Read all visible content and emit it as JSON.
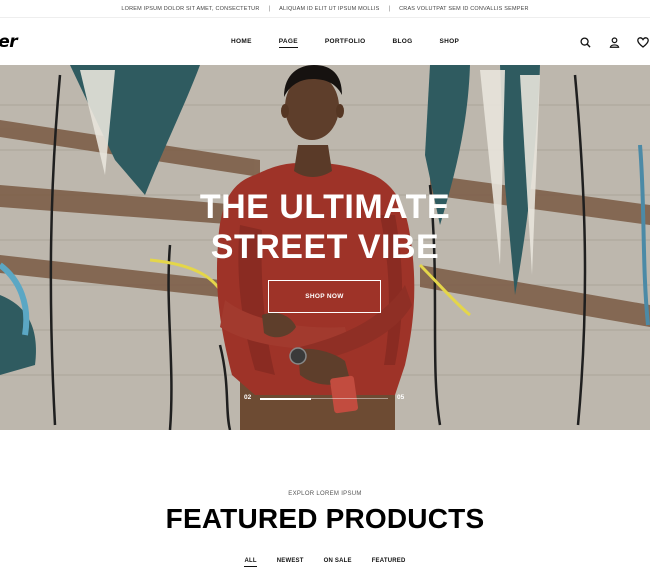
{
  "topbar": {
    "messages": [
      "LOREM IPSUM DOLOR SIT AMET, CONSECTETUR",
      "ALIQUAM ID ELIT UT IPSUM MOLLIS",
      "CRAS VOLUTPAT SEM ID CONVALLIS SEMPER"
    ],
    "separator": "|"
  },
  "header": {
    "logo_text": "ker",
    "nav": [
      "HOME",
      "PAGE",
      "PORTFOLIO",
      "BLOG",
      "SHOP"
    ],
    "active_nav": "PAGE",
    "icons": [
      "search-icon",
      "user-icon",
      "heart-icon"
    ]
  },
  "hero": {
    "title_line1": "THE ULTIMATE",
    "title_line2": "STREET VIBE",
    "cta_label": "SHOP NOW",
    "slide_current": "02",
    "slide_total": "05",
    "slide_progress": 0.4
  },
  "featured": {
    "eyebrow": "EXPLOR LOREM IPSUM",
    "title": "FEATURED PRODUCTS",
    "tabs": [
      "ALL",
      "NEWEST",
      "ON SALE",
      "FEATURED"
    ],
    "active_tab": "ALL"
  },
  "colors": {
    "text": "#111111",
    "hero_overlay_text": "#ffffff",
    "sweater": "#9e3328",
    "wall": "#bdb7ad"
  }
}
